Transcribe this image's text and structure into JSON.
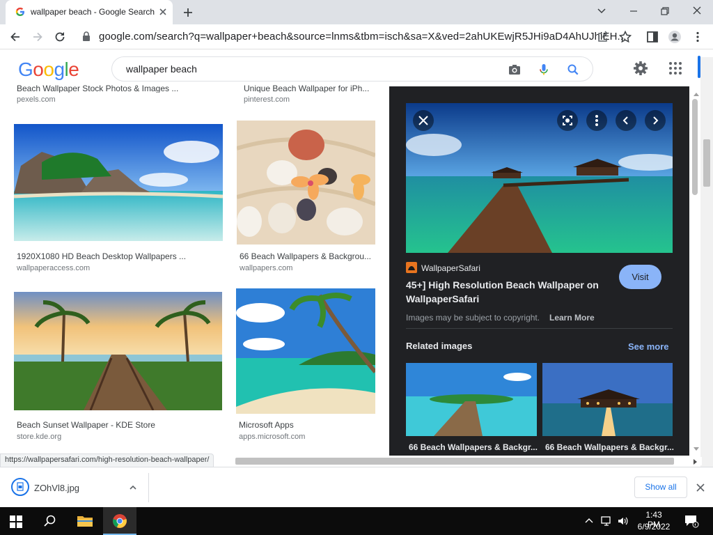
{
  "browser": {
    "tab_title": "wallpaper beach - Google Search",
    "url": "google.com/search?q=wallpaper+beach&source=lnms&tbm=isch&sa=X&ved=2ahUKEwjR5JHi9aD4AhUJhlEH..."
  },
  "google": {
    "logo": [
      "G",
      "o",
      "o",
      "g",
      "l",
      "e"
    ],
    "logo_colors": [
      "#4285f4",
      "#ea4335",
      "#fbbc05",
      "#4285f4",
      "#34a853",
      "#ea4335"
    ],
    "search_query": "wallpaper beach"
  },
  "results": [
    {
      "title": "Beach Wallpaper Stock Photos & Images ...",
      "site": "pexels.com"
    },
    {
      "title": "Unique Beach Wallpaper for iPh...",
      "site": "pinterest.com"
    },
    {
      "title": "1920X1080 HD Beach Desktop Wallpapers ...",
      "site": "wallpaperaccess.com"
    },
    {
      "title": "66 Beach Wallpapers & Backgrou...",
      "site": "wallpapers.com"
    },
    {
      "title": "Beach Sunset Wallpaper - KDE Store",
      "site": "store.kde.org"
    },
    {
      "title": "Microsoft Apps",
      "site": "apps.microsoft.com"
    }
  ],
  "preview": {
    "source": "WallpaperSafari",
    "title_line1": "45+] High Resolution Beach Wallpaper on",
    "title_line2": "WallpaperSafari",
    "visit_label": "Visit",
    "copyright": "Images may be subject to copyright.",
    "learn_more": "Learn More",
    "related_label": "Related images",
    "see_more": "See more",
    "related": [
      {
        "title": "66 Beach Wallpapers & Backgr..."
      },
      {
        "title": "66 Beach Wallpapers & Backgr..."
      }
    ]
  },
  "status_url": "https://wallpapersafari.com/high-resolution-beach-wallpaper/",
  "download": {
    "filename": "ZOhVl8.jpg",
    "show_all": "Show all"
  },
  "taskbar": {
    "time": "1:43 PM",
    "date": "6/9/2022"
  }
}
